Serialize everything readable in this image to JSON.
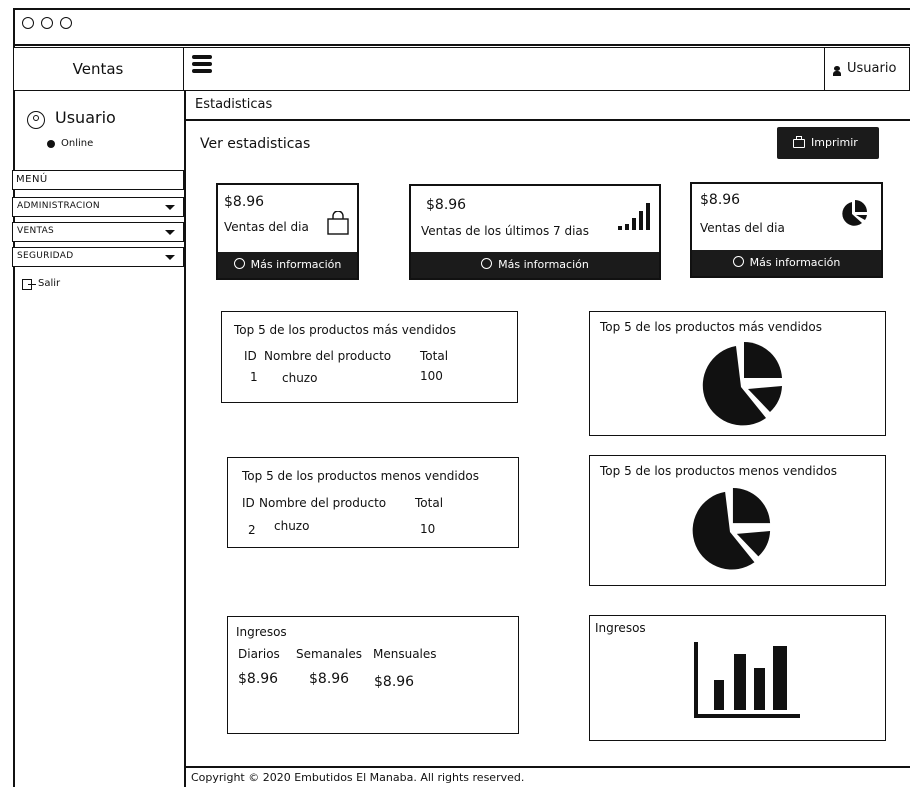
{
  "window": {
    "dots": [
      "circle-1",
      "circle-2",
      "circle-3"
    ]
  },
  "brand": {
    "title": "Ventas"
  },
  "topbar": {
    "user_label": "Usuario"
  },
  "sidebar": {
    "user_name": "Usuario",
    "status": "Online",
    "menu_header": "MENÚ",
    "items": [
      {
        "label": "ADMINISTRACION"
      },
      {
        "label": "VENTAS"
      },
      {
        "label": "SEGURIDAD"
      }
    ],
    "logout": "Salir"
  },
  "breadcrumb": {
    "title": "Estadisticas"
  },
  "main": {
    "subtitle": "Ver estadisticas",
    "print_label": "Imprimir"
  },
  "cards": [
    {
      "value": "$8.96",
      "label": "Ventas del dia",
      "more": "Más información",
      "icon": "shopping-bag-icon"
    },
    {
      "value": "$8.96",
      "label": "Ventas de los últimos 7 dias",
      "more": "Más información",
      "icon": "signal-bars-icon"
    },
    {
      "value": "$8.96",
      "label": "Ventas del dia",
      "more": "Más información",
      "icon": "pie-chart-icon"
    }
  ],
  "top_sold": {
    "title": "Top 5 de los productos más vendidos",
    "headers": [
      "ID",
      "Nombre del producto",
      "Total"
    ],
    "rows": [
      {
        "id": "1",
        "name": "chuzo",
        "total": "100"
      }
    ],
    "chart_title": "Top 5 de los productos más vendidos"
  },
  "least_sold": {
    "title": "Top 5 de los productos menos vendidos",
    "headers": [
      "ID",
      "Nombre del producto",
      "Total"
    ],
    "rows": [
      {
        "id": "2",
        "name": "chuzo",
        "total": "10"
      }
    ],
    "chart_title": "Top 5 de los productos menos vendidos"
  },
  "income": {
    "title": "Ingresos",
    "headers": [
      "Diarios",
      "Semanales",
      "Mensuales"
    ],
    "values": [
      "$8.96",
      "$8.96",
      "$8.96"
    ],
    "chart_title": "Ingresos"
  },
  "footer": {
    "text": "Copyright © 2020 Embutidos El Manaba. All rights reserved."
  }
}
